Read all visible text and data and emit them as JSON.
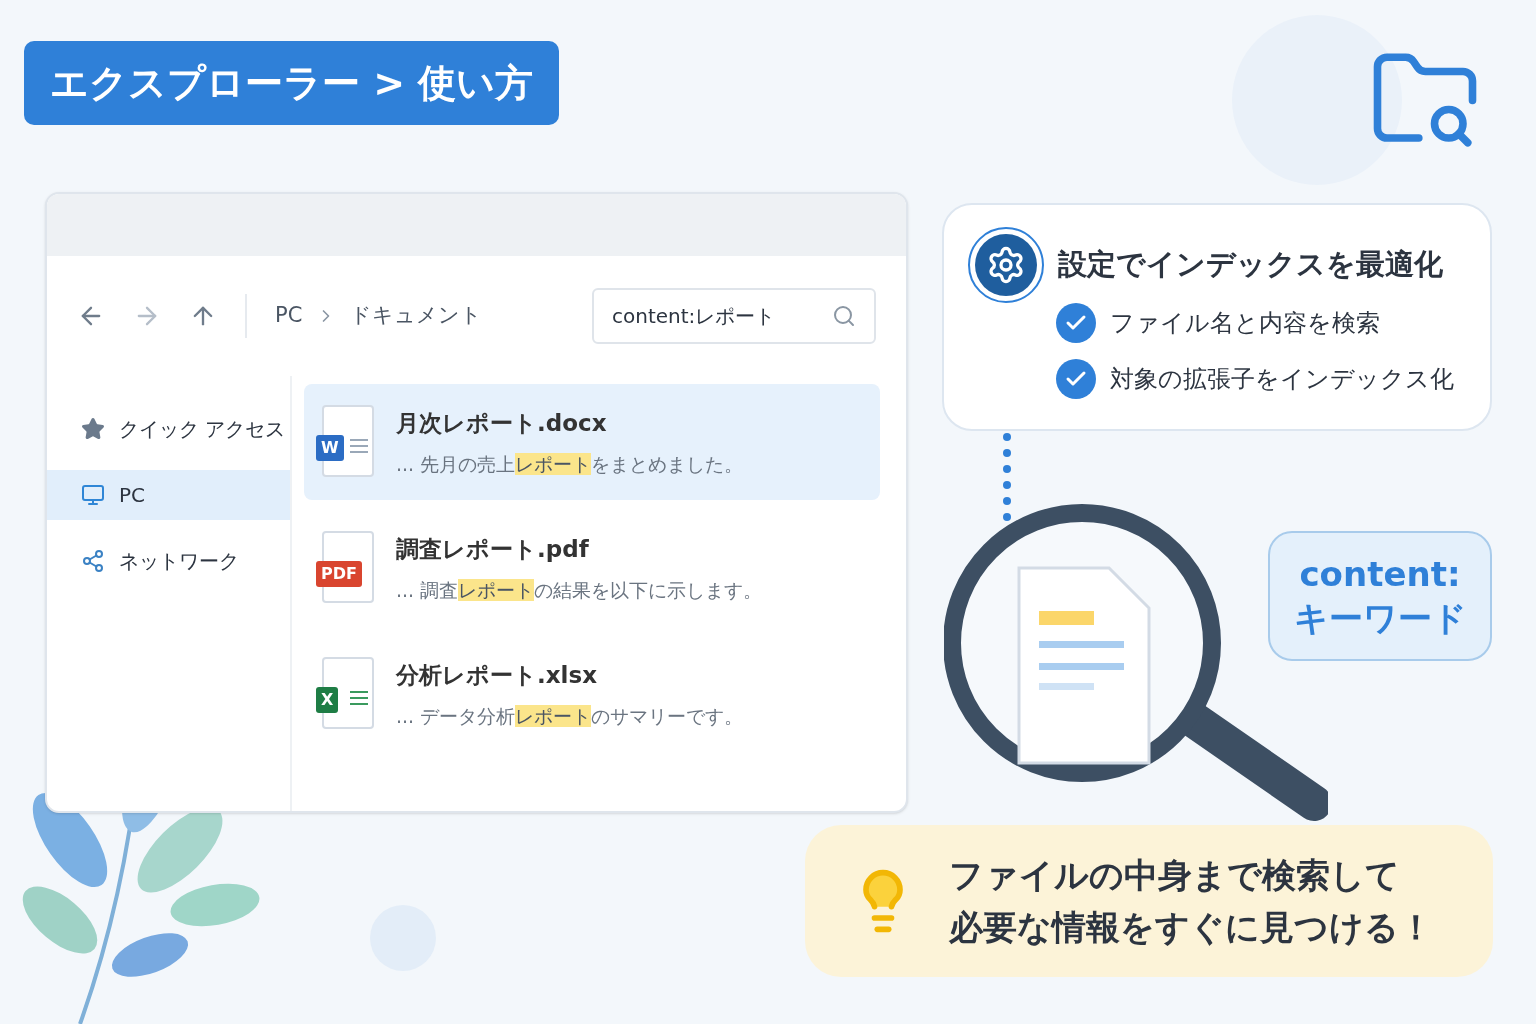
{
  "title": "エクスプローラー > 使い方",
  "explorer": {
    "breadcrumb": [
      "PC",
      "ドキュメント"
    ],
    "search": {
      "value": "content:レポート"
    },
    "sidebar": [
      {
        "label": "クイック アクセス",
        "kind": "star",
        "selected": false
      },
      {
        "label": "PC",
        "kind": "monitor",
        "selected": true
      },
      {
        "label": "ネットワーク",
        "kind": "network",
        "selected": false
      }
    ],
    "files": [
      {
        "name": "月次レポート.docx",
        "kind": "word",
        "badge": "W",
        "selected": true,
        "before": "... 先月の売上",
        "match": "レポート",
        "after": "をまとめました。"
      },
      {
        "name": "調査レポート.pdf",
        "kind": "pdf",
        "badge": "PDF",
        "selected": false,
        "before": "... 調査",
        "match": "レポート",
        "after": "の結果を以下に示します。"
      },
      {
        "name": "分析レポート.xlsx",
        "kind": "excel",
        "badge": "X",
        "selected": false,
        "before": "... データ分析",
        "match": "レポート",
        "after": "のサマリーです。"
      }
    ]
  },
  "tips_card": {
    "title": "設定でインデックスを最適化",
    "items": [
      {
        "label": "ファイル名と内容を検索",
        "checked": true
      },
      {
        "label": "対象の拡張子をインデックス化",
        "checked": true
      }
    ]
  },
  "bubble": [
    "content:",
    "キーワード"
  ],
  "note": [
    "ファイルの中身まで検索して",
    "必要な情報をすぐに見つける！"
  ]
}
